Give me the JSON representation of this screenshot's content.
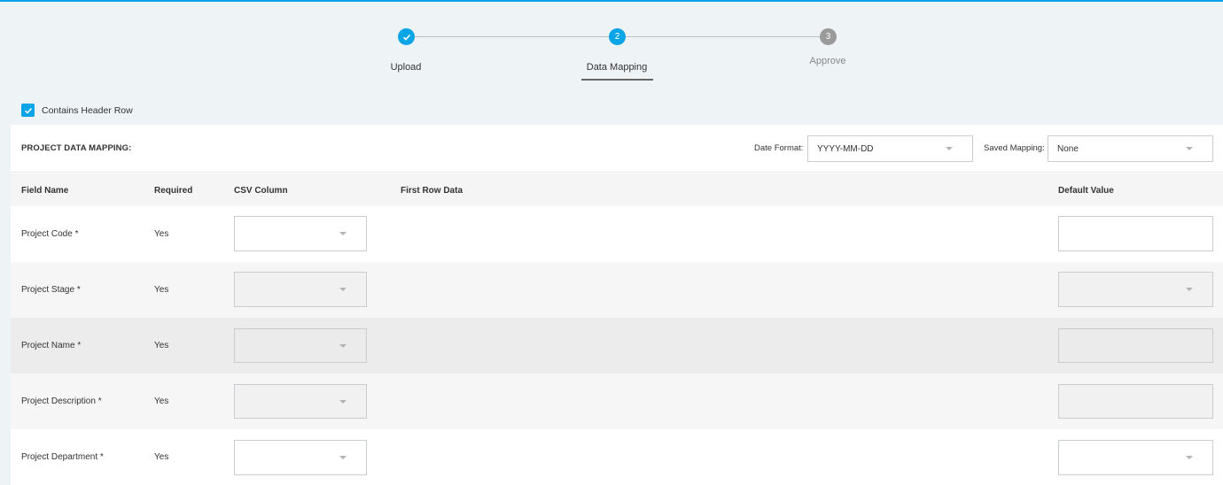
{
  "stepper": {
    "steps": [
      {
        "number": "",
        "label": "Upload",
        "state": "done"
      },
      {
        "number": "2",
        "label": "Data Mapping",
        "state": "active"
      },
      {
        "number": "3",
        "label": "Approve",
        "state": "pending"
      }
    ]
  },
  "header_row": {
    "label": "Contains Header Row",
    "checked": true
  },
  "mapping": {
    "title": "PROJECT DATA MAPPING:",
    "date_format_label": "Date Format:",
    "date_format_value": "YYYY-MM-DD",
    "saved_mapping_label": "Saved Mapping:",
    "saved_mapping_value": "None"
  },
  "table": {
    "columns": [
      "Field Name",
      "Required",
      "CSV Column",
      "First Row Data",
      "Default Value"
    ],
    "rows": [
      {
        "field": "Project Code *",
        "required": "Yes"
      },
      {
        "field": "Project Stage *",
        "required": "Yes"
      },
      {
        "field": "Project Name *",
        "required": "Yes"
      },
      {
        "field": "Project Description *",
        "required": "Yes"
      },
      {
        "field": "Project Department *",
        "required": "Yes"
      }
    ]
  },
  "colors": {
    "accent": "#0aa5e6",
    "pending": "#9a9a9a"
  }
}
